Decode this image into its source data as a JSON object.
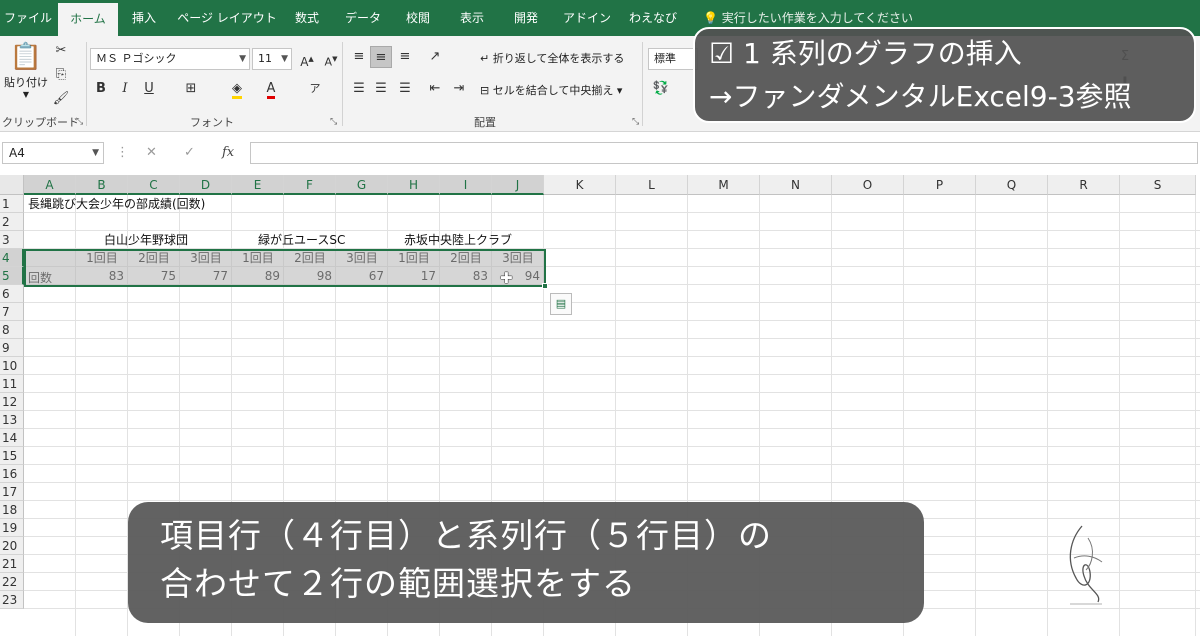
{
  "tabs": [
    "ファイル",
    "ホーム",
    "挿入",
    "ページ レイアウト",
    "数式",
    "データ",
    "校閲",
    "表示",
    "開発",
    "アドイン",
    "わえなび"
  ],
  "active_tab": "ホーム",
  "tell_me": "実行したい作業を入力してください",
  "ribbon": {
    "clipboard": {
      "paste_label": "貼り付け",
      "group_label": "クリップボード"
    },
    "font": {
      "font_name": "ＭＳ Ｐゴシック",
      "font_size": "11",
      "group_label": "フォント",
      "bold": "B",
      "italic": "I",
      "underline": "U"
    },
    "alignment": {
      "wrap_text": "折り返して全体を表示する",
      "merge_center": "セルを結合して中央揃え",
      "group_label": "配置"
    },
    "number": {
      "format": "標準"
    }
  },
  "formula_bar": {
    "name_box": "A4",
    "cancel": "✕",
    "enter": "✓",
    "fx": "fx",
    "formula": ""
  },
  "columns": [
    "A",
    "B",
    "C",
    "D",
    "E",
    "F",
    "G",
    "H",
    "I",
    "J",
    "K",
    "L",
    "M",
    "N",
    "O",
    "P",
    "Q",
    "R",
    "S"
  ],
  "rows": [
    "1",
    "2",
    "3",
    "4",
    "5",
    "6",
    "7",
    "8",
    "9",
    "10",
    "11",
    "12",
    "13",
    "14",
    "15",
    "16",
    "17",
    "18",
    "19",
    "20",
    "21",
    "22",
    "23"
  ],
  "sheet": {
    "title": "長縄跳び大会少年の部成績(回数)",
    "team1": "白山少年野球団",
    "team2": "緑が丘ユースSC",
    "team3": "赤坂中央陸上クラブ",
    "round_headers": [
      "1回目",
      "2回目",
      "3回目",
      "1回目",
      "2回目",
      "3回目",
      "1回目",
      "2回目",
      "3回目"
    ],
    "row5_label": "回数",
    "row5_values": [
      "83",
      "75",
      "77",
      "89",
      "98",
      "67",
      "17",
      "83",
      "94"
    ]
  },
  "callout_top": {
    "line1": "☑ 1 系列のグラフの挿入",
    "line2": "→ファンダメンタルExcel9-3参照"
  },
  "callout_bottom": {
    "line1": "項目行（４行目）と系列行（５行目）の",
    "line2": "合わせて２行の範囲選択をする"
  },
  "colors": {
    "excel_green": "#217346",
    "ribbon_bg": "#f3f3f3",
    "overlay": "#555555"
  }
}
